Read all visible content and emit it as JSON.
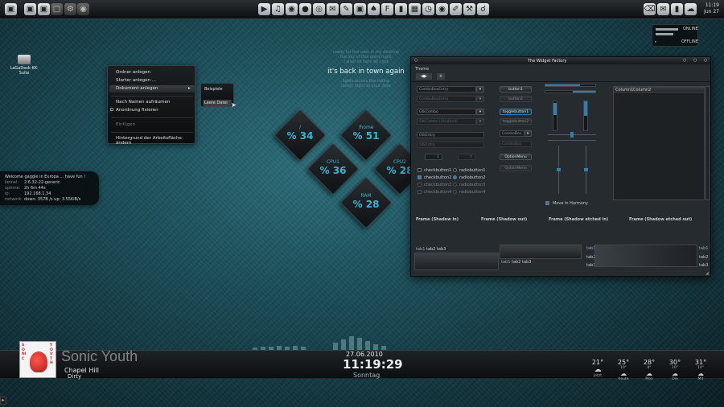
{
  "top_panel": {
    "left_icons": [
      "terminal-icon",
      "browser-icon",
      "folder-icon",
      "window-icon",
      "gear-icon",
      "web-icon"
    ],
    "center_icons": [
      "player-icon",
      "music-icon",
      "camera-icon",
      "chat-icon",
      "globe-icon",
      "mail-icon",
      "editor-icon",
      "photo-icon",
      "game-icon",
      "font-icon",
      "terminal-icon",
      "calendar-icon",
      "clock-icon",
      "disc-icon",
      "paint-icon",
      "tools-icon",
      "network-icon"
    ],
    "right_icons": [
      "trash-icon",
      "mail-icon",
      "battery-icon",
      "volume-icon",
      "weather-icon"
    ],
    "clock_time": "11:19",
    "clock_date": "Jun 27"
  },
  "online_widget": {
    "online": "ONLINE",
    "offline": "OFFLINE"
  },
  "desktop_icon": {
    "label1": "LaGaDesk-KK-",
    "label2": "Suite"
  },
  "context_menu": {
    "items": [
      "Ordner anlegen",
      "Starter anlegen ...",
      "Dokument anlegen",
      "Nach Namen aufräumen",
      "Anordnung fixieren",
      "Einfügen",
      "Hintergrund der Arbeitsfläche ändern"
    ],
    "submenu": [
      "Beispiele",
      "Leere Datei"
    ]
  },
  "center_text": {
    "line1": "ready for the next in my desktop",
    "line2": "the sky of this quiet night",
    "line3": "I shall sit here all I got",
    "line4": "it's back in town again",
    "line5": "lights across the rolling",
    "line6": "lonely night at your door"
  },
  "diamonds": [
    {
      "title": "/",
      "value": "% 34"
    },
    {
      "title": "/home",
      "value": "% 51"
    },
    {
      "title": "CPU1",
      "value": "% 36"
    },
    {
      "title": "CPU2",
      "value": "% 28"
    },
    {
      "title": "RAM",
      "value": "% 28"
    }
  ],
  "sysinfo": {
    "welcome": "Welcome gaggle in Europa ... have fun !",
    "kernel_k": "kernel:",
    "kernel_v": "2.6.32-22-generic",
    "uptime_k": "uptime:",
    "uptime_v": "2h 6m 44s",
    "ip_k": "ip:",
    "ip_v": "192.168.1.34",
    "network_k": "network:",
    "network_v": "down: 357B /s   up: 3.55KiB/s"
  },
  "widget_factory": {
    "title": "The Widget Factory",
    "menu_theme": "Theme",
    "combo1": "ComboBoxEntry",
    "combo2": "ComboBoxEntry",
    "gtk_combo": "GtkCombo",
    "gtk_combo_dis": "GtkCombo (disabled)",
    "entry": "GtkEntry",
    "entry_dis": "GtkEntry",
    "spin1": "1",
    "spin2": "0",
    "checks": [
      "checkbutton1",
      "checkbutton2",
      "checkbutton3",
      "checkbutton4"
    ],
    "radios": [
      "radiobutton1",
      "radiobutton2",
      "radiobutton3",
      "radiobutton4"
    ],
    "button1": "button1",
    "button2": "button2",
    "toggle1": "togglebutton1",
    "toggle2": "togglebutton2",
    "combobox1": "ComboBox",
    "combobox2": "ComboBox",
    "option1": "OptionMenu",
    "option2": "OptionMenu",
    "move_harmony": "Move in Harmony",
    "col1": "Column1",
    "col2": "Column2",
    "frames": [
      "Frame (Shadow in)",
      "Frame (Shadow out)",
      "Frame (Shadow etched in)",
      "Frame (Shadow etched out)"
    ],
    "tabs": [
      "tab1",
      "tab2",
      "tab3"
    ]
  },
  "dock": {
    "artist": "Sonic Youth",
    "song": "Chapel Hill",
    "album": "Dirty",
    "album_art_text1": "SONIC",
    "album_art_text2": "YOUTH",
    "date": "27.06.2010",
    "time": "11:19:29",
    "weekday": "Sonntag"
  },
  "weather": [
    {
      "temp": "21°",
      "lo": "",
      "day": "Jetzt"
    },
    {
      "temp": "25°",
      "lo": "10°",
      "day": "heute"
    },
    {
      "temp": "28°",
      "lo": "8°",
      "day": "Mon"
    },
    {
      "temp": "30°",
      "lo": "10°",
      "day": "Die"
    },
    {
      "temp": "31°",
      "lo": "14°",
      "day": "Mit"
    }
  ],
  "colors": {
    "accent": "#36b6d4",
    "panel": "#15181a",
    "highlight": "#2f7fb0"
  }
}
